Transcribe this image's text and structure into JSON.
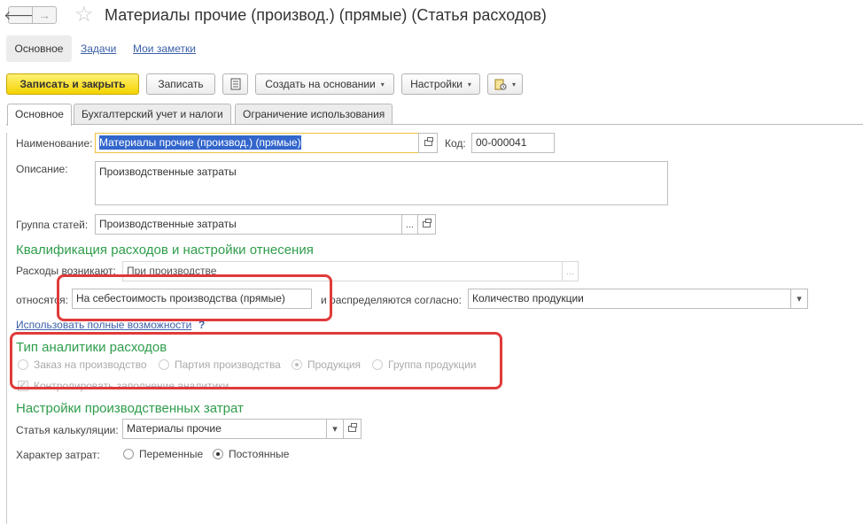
{
  "window": {
    "title": "Материалы прочие (производ.) (прямые) (Статья расходов)",
    "back_glyph": "🡐",
    "forward_glyph": "→"
  },
  "nav_tabs": [
    {
      "label": "Основное"
    },
    {
      "label": "Задачи"
    },
    {
      "label": "Мои заметки"
    }
  ],
  "toolbar": {
    "save_close_label": "Записать и закрыть",
    "save_label": "Записать",
    "create_based_label": "Создать на основании",
    "settings_label": "Настройки"
  },
  "tabs": [
    {
      "label": "Основное"
    },
    {
      "label": "Бухгалтерский учет и налоги"
    },
    {
      "label": "Ограничение использования"
    }
  ],
  "form": {
    "name_label": "Наименование:",
    "name_value": "Материалы прочие (производ.) (прямые)",
    "code_label": "Код:",
    "code_value": "00-000041",
    "description_label": "Описание:",
    "description_value": "Производственные затраты",
    "group_label": "Группа статей:",
    "group_value": "Производственные затраты"
  },
  "qualification": {
    "title": "Квалификация расходов и настройки отнесения",
    "arise_label": "Расходы возникают:",
    "arise_value": "При производстве",
    "assign_label": "относятся:",
    "assign_value": "На себестоимость производства (прямые)",
    "distribute_label": "и распределяются согласно:",
    "distribute_value": "Количество продукции",
    "full_features_link": "Использовать полные возможности",
    "help": "?"
  },
  "analytics": {
    "title": "Тип аналитики расходов",
    "options": [
      {
        "label": "Заказ на производство"
      },
      {
        "label": "Партия производства"
      },
      {
        "label": "Продукция"
      },
      {
        "label": "Группа продукции"
      }
    ],
    "selected_index": 2,
    "control_label": "Контролировать заполнение аналитики",
    "control_checked": true
  },
  "production": {
    "title": "Настройки производственных затрат",
    "calc_label": "Статья калькуляции:",
    "calc_value": "Материалы прочие",
    "nature_label": "Характер затрат:",
    "nature_options": [
      {
        "label": "Переменные"
      },
      {
        "label": "Постоянные"
      }
    ],
    "nature_selected_index": 1
  },
  "icons": {
    "star": "☆",
    "ellipsis": "...",
    "dropdown": "▾",
    "check": "✓"
  },
  "colors": {
    "accent_green": "#2e9d4b",
    "primary_button": "#f4d200",
    "highlight_red": "#e03a3a",
    "link_blue": "#3b5fa7"
  }
}
